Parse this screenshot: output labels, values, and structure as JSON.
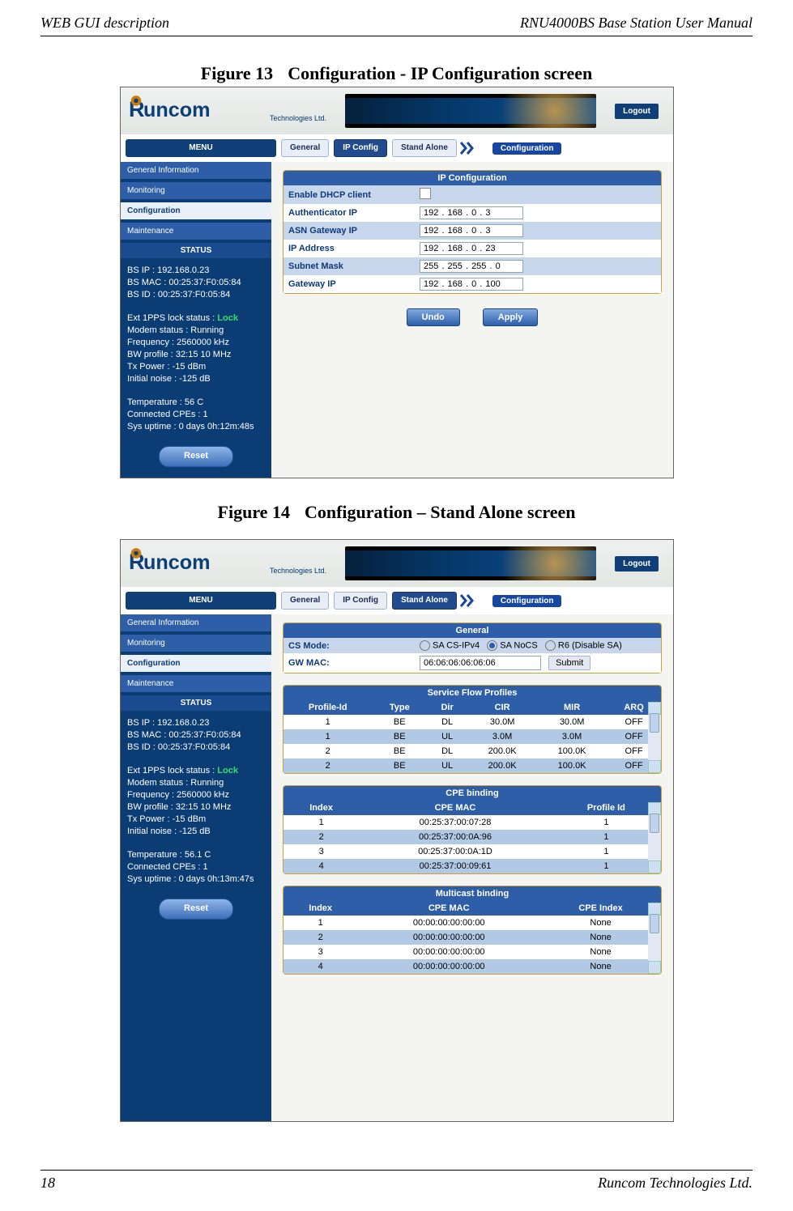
{
  "header": {
    "left": "WEB GUI description",
    "right": "RNU4000BS Base Station User Manual"
  },
  "footer": {
    "left": "18",
    "right": "Runcom Technologies Ltd."
  },
  "figures": {
    "f1": {
      "num": "Figure 13",
      "title": "Configuration - IP Configuration screen"
    },
    "f2": {
      "num": "Figure 14",
      "title": "Configuration – Stand Alone screen"
    }
  },
  "logo": {
    "brand": "uncom",
    "sub": "Technologies Ltd."
  },
  "logout": "Logout",
  "menu": {
    "label": "MENU",
    "tabs": [
      "General",
      "IP Config",
      "Stand Alone"
    ],
    "tag": "Configuration"
  },
  "sidebar": {
    "items": [
      "General Information",
      "Monitoring",
      "Configuration",
      "Maintenance"
    ],
    "status_title": "STATUS",
    "status1": [
      "BS IP :  192.168.0.23",
      "BS MAC :  00:25:37:F0:05:84",
      "BS ID :  00:25:37:F0:05:84"
    ],
    "lock_lbl": "Ext 1PPS lock status :",
    "lock_val": "Lock",
    "status2": [
      "Modem status :  Running",
      "Frequency :  2560000 kHz",
      "BW profile :  32:15 10 MHz",
      "Tx Power :  -15 dBm",
      "Initial noise :  -125 dB"
    ],
    "status3a": [
      "Temperature :  56 C",
      "Connected CPEs :  1",
      "Sys uptime :  0 days 0h:12m:48s"
    ],
    "status3b": [
      "Temperature :  56.1 C",
      "Connected CPEs : 1",
      "Sys uptime :  0 days 0h:13m:47s"
    ],
    "reset": "Reset"
  },
  "ipcfg": {
    "title": "IP Configuration",
    "rows": [
      {
        "label": "Enable DHCP client",
        "type": "check"
      },
      {
        "label": "Authenticator IP",
        "ip": [
          "192",
          "168",
          "0",
          "3"
        ]
      },
      {
        "label": "ASN Gateway IP",
        "ip": [
          "192",
          "168",
          "0",
          "3"
        ]
      },
      {
        "label": "IP Address",
        "ip": [
          "192",
          "168",
          "0",
          "23"
        ]
      },
      {
        "label": "Subnet Mask",
        "ip": [
          "255",
          "255",
          "255",
          "0"
        ]
      },
      {
        "label": "Gateway IP",
        "ip": [
          "192",
          "168",
          "0",
          "100"
        ]
      }
    ],
    "undo": "Undo",
    "apply": "Apply"
  },
  "sa": {
    "general": {
      "title": "General",
      "cs_label": "CS Mode:",
      "opts": [
        "SA CS-IPv4",
        "SA NoCS",
        "R6 (Disable SA)"
      ],
      "sel": 1,
      "gw_label": "GW MAC:",
      "gw_val": "06:06:06:06:06:06",
      "submit": "Submit"
    },
    "sfp": {
      "title": "Service Flow Profiles",
      "cols": [
        "Profile-Id",
        "Type",
        "Dir",
        "CIR",
        "MIR",
        "ARQ"
      ],
      "rows": [
        [
          "1",
          "BE",
          "DL",
          "30.0M",
          "30.0M",
          "OFF"
        ],
        [
          "1",
          "BE",
          "UL",
          "3.0M",
          "3.0M",
          "OFF"
        ],
        [
          "2",
          "BE",
          "DL",
          "200.0K",
          "100.0K",
          "OFF"
        ],
        [
          "2",
          "BE",
          "UL",
          "200.0K",
          "100.0K",
          "OFF"
        ]
      ]
    },
    "cpe": {
      "title": "CPE binding",
      "cols": [
        "Index",
        "CPE MAC",
        "Profile Id"
      ],
      "rows": [
        [
          "1",
          "00:25:37:00:07:28",
          "1"
        ],
        [
          "2",
          "00:25:37:00:0A:96",
          "1"
        ],
        [
          "3",
          "00:25:37:00:0A:1D",
          "1"
        ],
        [
          "4",
          "00:25:37:00:09:61",
          "1"
        ]
      ]
    },
    "mc": {
      "title": "Multicast binding",
      "cols": [
        "Index",
        "CPE MAC",
        "CPE Index"
      ],
      "rows": [
        [
          "1",
          "00:00:00:00:00:00",
          "None"
        ],
        [
          "2",
          "00:00:00:00:00:00",
          "None"
        ],
        [
          "3",
          "00:00:00:00:00:00",
          "None"
        ],
        [
          "4",
          "00:00:00:00:00:00",
          "None"
        ]
      ]
    }
  }
}
